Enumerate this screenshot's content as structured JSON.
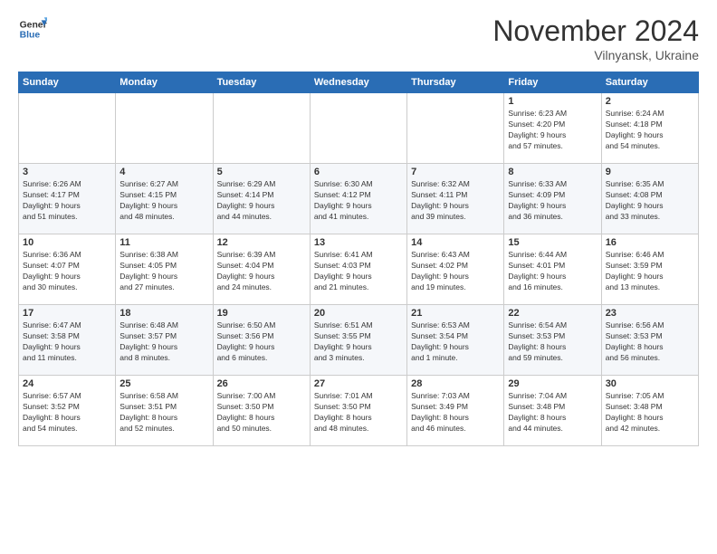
{
  "header": {
    "logo_line1": "General",
    "logo_line2": "Blue",
    "month_title": "November 2024",
    "subtitle": "Vilnyansk, Ukraine"
  },
  "weekdays": [
    "Sunday",
    "Monday",
    "Tuesday",
    "Wednesday",
    "Thursday",
    "Friday",
    "Saturday"
  ],
  "weeks": [
    [
      {
        "day": "",
        "info": ""
      },
      {
        "day": "",
        "info": ""
      },
      {
        "day": "",
        "info": ""
      },
      {
        "day": "",
        "info": ""
      },
      {
        "day": "",
        "info": ""
      },
      {
        "day": "1",
        "info": "Sunrise: 6:23 AM\nSunset: 4:20 PM\nDaylight: 9 hours\nand 57 minutes."
      },
      {
        "day": "2",
        "info": "Sunrise: 6:24 AM\nSunset: 4:18 PM\nDaylight: 9 hours\nand 54 minutes."
      }
    ],
    [
      {
        "day": "3",
        "info": "Sunrise: 6:26 AM\nSunset: 4:17 PM\nDaylight: 9 hours\nand 51 minutes."
      },
      {
        "day": "4",
        "info": "Sunrise: 6:27 AM\nSunset: 4:15 PM\nDaylight: 9 hours\nand 48 minutes."
      },
      {
        "day": "5",
        "info": "Sunrise: 6:29 AM\nSunset: 4:14 PM\nDaylight: 9 hours\nand 44 minutes."
      },
      {
        "day": "6",
        "info": "Sunrise: 6:30 AM\nSunset: 4:12 PM\nDaylight: 9 hours\nand 41 minutes."
      },
      {
        "day": "7",
        "info": "Sunrise: 6:32 AM\nSunset: 4:11 PM\nDaylight: 9 hours\nand 39 minutes."
      },
      {
        "day": "8",
        "info": "Sunrise: 6:33 AM\nSunset: 4:09 PM\nDaylight: 9 hours\nand 36 minutes."
      },
      {
        "day": "9",
        "info": "Sunrise: 6:35 AM\nSunset: 4:08 PM\nDaylight: 9 hours\nand 33 minutes."
      }
    ],
    [
      {
        "day": "10",
        "info": "Sunrise: 6:36 AM\nSunset: 4:07 PM\nDaylight: 9 hours\nand 30 minutes."
      },
      {
        "day": "11",
        "info": "Sunrise: 6:38 AM\nSunset: 4:05 PM\nDaylight: 9 hours\nand 27 minutes."
      },
      {
        "day": "12",
        "info": "Sunrise: 6:39 AM\nSunset: 4:04 PM\nDaylight: 9 hours\nand 24 minutes."
      },
      {
        "day": "13",
        "info": "Sunrise: 6:41 AM\nSunset: 4:03 PM\nDaylight: 9 hours\nand 21 minutes."
      },
      {
        "day": "14",
        "info": "Sunrise: 6:43 AM\nSunset: 4:02 PM\nDaylight: 9 hours\nand 19 minutes."
      },
      {
        "day": "15",
        "info": "Sunrise: 6:44 AM\nSunset: 4:01 PM\nDaylight: 9 hours\nand 16 minutes."
      },
      {
        "day": "16",
        "info": "Sunrise: 6:46 AM\nSunset: 3:59 PM\nDaylight: 9 hours\nand 13 minutes."
      }
    ],
    [
      {
        "day": "17",
        "info": "Sunrise: 6:47 AM\nSunset: 3:58 PM\nDaylight: 9 hours\nand 11 minutes."
      },
      {
        "day": "18",
        "info": "Sunrise: 6:48 AM\nSunset: 3:57 PM\nDaylight: 9 hours\nand 8 minutes."
      },
      {
        "day": "19",
        "info": "Sunrise: 6:50 AM\nSunset: 3:56 PM\nDaylight: 9 hours\nand 6 minutes."
      },
      {
        "day": "20",
        "info": "Sunrise: 6:51 AM\nSunset: 3:55 PM\nDaylight: 9 hours\nand 3 minutes."
      },
      {
        "day": "21",
        "info": "Sunrise: 6:53 AM\nSunset: 3:54 PM\nDaylight: 9 hours\nand 1 minute."
      },
      {
        "day": "22",
        "info": "Sunrise: 6:54 AM\nSunset: 3:53 PM\nDaylight: 8 hours\nand 59 minutes."
      },
      {
        "day": "23",
        "info": "Sunrise: 6:56 AM\nSunset: 3:53 PM\nDaylight: 8 hours\nand 56 minutes."
      }
    ],
    [
      {
        "day": "24",
        "info": "Sunrise: 6:57 AM\nSunset: 3:52 PM\nDaylight: 8 hours\nand 54 minutes."
      },
      {
        "day": "25",
        "info": "Sunrise: 6:58 AM\nSunset: 3:51 PM\nDaylight: 8 hours\nand 52 minutes."
      },
      {
        "day": "26",
        "info": "Sunrise: 7:00 AM\nSunset: 3:50 PM\nDaylight: 8 hours\nand 50 minutes."
      },
      {
        "day": "27",
        "info": "Sunrise: 7:01 AM\nSunset: 3:50 PM\nDaylight: 8 hours\nand 48 minutes."
      },
      {
        "day": "28",
        "info": "Sunrise: 7:03 AM\nSunset: 3:49 PM\nDaylight: 8 hours\nand 46 minutes."
      },
      {
        "day": "29",
        "info": "Sunrise: 7:04 AM\nSunset: 3:48 PM\nDaylight: 8 hours\nand 44 minutes."
      },
      {
        "day": "30",
        "info": "Sunrise: 7:05 AM\nSunset: 3:48 PM\nDaylight: 8 hours\nand 42 minutes."
      }
    ]
  ]
}
